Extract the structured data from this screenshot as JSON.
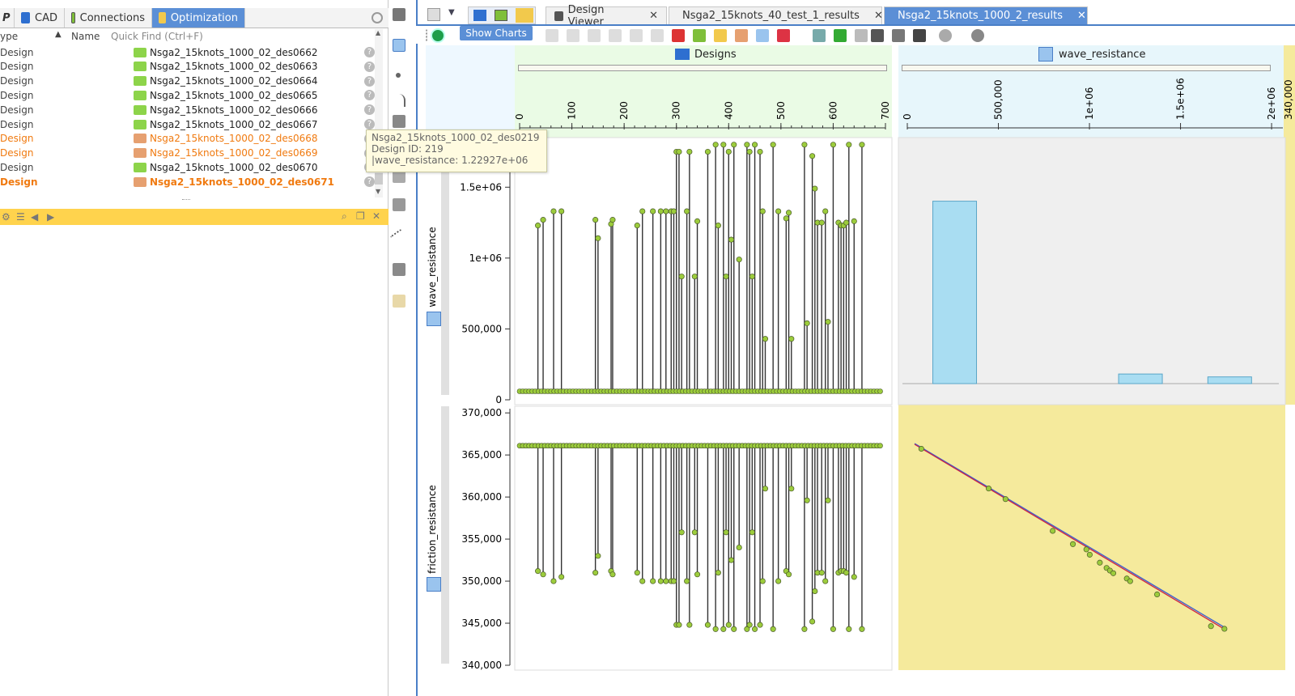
{
  "left_panel": {
    "tabs": [
      {
        "label": "P"
      },
      {
        "label": "CAD"
      },
      {
        "label": "Connections"
      },
      {
        "label": "Optimization"
      }
    ],
    "columns": {
      "type": "ype",
      "name": "Name",
      "quick_find": "Quick Find (Ctrl+F)"
    },
    "rows": [
      {
        "type": "Design",
        "name": "Nsga2_15knots_1000_02_des0662",
        "style": "normal"
      },
      {
        "type": "Design",
        "name": "Nsga2_15knots_1000_02_des0663",
        "style": "normal"
      },
      {
        "type": "Design",
        "name": "Nsga2_15knots_1000_02_des0664",
        "style": "normal"
      },
      {
        "type": "Design",
        "name": "Nsga2_15knots_1000_02_des0665",
        "style": "normal"
      },
      {
        "type": "Design",
        "name": "Nsga2_15knots_1000_02_des0666",
        "style": "normal"
      },
      {
        "type": "Design",
        "name": "Nsga2_15knots_1000_02_des0667",
        "style": "normal"
      },
      {
        "type": "Design",
        "name": "Nsga2_15knots_1000_02_des0668",
        "style": "orange"
      },
      {
        "type": "Design",
        "name": "Nsga2_15knots_1000_02_des0669",
        "style": "orange"
      },
      {
        "type": "Design",
        "name": "Nsga2_15knots_1000_02_des0670",
        "style": "normal"
      },
      {
        "type": "Design",
        "name": "Nsga2_15knots_1000_02_des0671",
        "style": "bold"
      }
    ]
  },
  "doc_tabs": [
    {
      "label": "Design Viewer"
    },
    {
      "label": "Nsga2_15knots_40_test_1_results"
    },
    {
      "label": "Nsga2_15knots_1000_2_results"
    }
  ],
  "toolbar": {
    "show_charts": "Show Charts"
  },
  "tooltip": {
    "line1": "Nsga2_15knots_1000_02_des0219",
    "line2": "Design ID: 219",
    "line3": "|wave_resistance: 1.22927e+06"
  },
  "panels": {
    "designs_title": "Designs",
    "wave_title": "wave_resistance"
  },
  "chart_data": [
    {
      "type": "scatter",
      "title": "",
      "xlabel": "Designs",
      "ylabel": "wave_resistance",
      "x_ticks": [
        "0",
        "100",
        "200",
        "300",
        "400",
        "500",
        "600",
        "700"
      ],
      "y_ticks": [
        "0",
        "500,000",
        "1e+06",
        "1.5e+06"
      ],
      "xlim": [
        0,
        700
      ],
      "ylim": [
        0,
        1850000
      ],
      "baseline": 60000,
      "spikes": [
        [
          35,
          1230000
        ],
        [
          45,
          1270000
        ],
        [
          65,
          1330000
        ],
        [
          80,
          1330000
        ],
        [
          145,
          1270000
        ],
        [
          150,
          1140000
        ],
        [
          175,
          1240000
        ],
        [
          178,
          1270000
        ],
        [
          225,
          1230000
        ],
        [
          235,
          1330000
        ],
        [
          255,
          1330000
        ],
        [
          270,
          1330000
        ],
        [
          280,
          1330000
        ],
        [
          290,
          1330000
        ],
        [
          295,
          1330000
        ],
        [
          300,
          1750000
        ],
        [
          305,
          1750000
        ],
        [
          310,
          870000
        ],
        [
          320,
          1330000
        ],
        [
          325,
          1750000
        ],
        [
          335,
          870000
        ],
        [
          340,
          1260000
        ],
        [
          360,
          1750000
        ],
        [
          375,
          1800000
        ],
        [
          380,
          1230000
        ],
        [
          390,
          1800000
        ],
        [
          395,
          870000
        ],
        [
          400,
          1750000
        ],
        [
          405,
          1130000
        ],
        [
          410,
          1800000
        ],
        [
          420,
          990000
        ],
        [
          435,
          1800000
        ],
        [
          440,
          1750000
        ],
        [
          445,
          870000
        ],
        [
          450,
          1800000
        ],
        [
          460,
          1750000
        ],
        [
          465,
          1330000
        ],
        [
          470,
          430000
        ],
        [
          485,
          1800000
        ],
        [
          495,
          1330000
        ],
        [
          510,
          1280000
        ],
        [
          515,
          1320000
        ],
        [
          520,
          430000
        ],
        [
          545,
          1800000
        ],
        [
          550,
          540000
        ],
        [
          560,
          1720000
        ],
        [
          565,
          1490000
        ],
        [
          570,
          1250000
        ],
        [
          578,
          1250000
        ],
        [
          585,
          1330000
        ],
        [
          590,
          550000
        ],
        [
          600,
          1800000
        ],
        [
          610,
          1250000
        ],
        [
          615,
          1230000
        ],
        [
          620,
          1230000
        ],
        [
          625,
          1250000
        ],
        [
          630,
          1800000
        ],
        [
          640,
          1260000
        ],
        [
          655,
          1800000
        ]
      ]
    },
    {
      "type": "scatter",
      "title": "",
      "xlabel": "",
      "ylabel": "friction_resistance",
      "x_ticks": [],
      "y_ticks": [
        "340,000",
        "345,000",
        "350,000",
        "355,000",
        "360,000",
        "365,000",
        "370,000"
      ],
      "xlim": [
        0,
        700
      ],
      "ylim": [
        340000,
        370500
      ],
      "baseline": 366100,
      "spikes": [
        [
          35,
          351200
        ],
        [
          45,
          350800
        ],
        [
          65,
          350000
        ],
        [
          80,
          350500
        ],
        [
          145,
          351000
        ],
        [
          150,
          353000
        ],
        [
          175,
          351200
        ],
        [
          178,
          350800
        ],
        [
          225,
          351000
        ],
        [
          235,
          350000
        ],
        [
          255,
          350000
        ],
        [
          270,
          350000
        ],
        [
          280,
          350000
        ],
        [
          290,
          350000
        ],
        [
          295,
          350000
        ],
        [
          300,
          344800
        ],
        [
          305,
          344800
        ],
        [
          310,
          355800
        ],
        [
          320,
          350000
        ],
        [
          325,
          344800
        ],
        [
          335,
          355800
        ],
        [
          340,
          350800
        ],
        [
          360,
          344800
        ],
        [
          375,
          344300
        ],
        [
          380,
          351000
        ],
        [
          390,
          344300
        ],
        [
          395,
          355800
        ],
        [
          400,
          344800
        ],
        [
          405,
          352500
        ],
        [
          410,
          344300
        ],
        [
          420,
          354000
        ],
        [
          435,
          344300
        ],
        [
          440,
          344800
        ],
        [
          445,
          355800
        ],
        [
          450,
          344300
        ],
        [
          460,
          344800
        ],
        [
          465,
          350000
        ],
        [
          470,
          361000
        ],
        [
          485,
          344300
        ],
        [
          495,
          350000
        ],
        [
          510,
          351200
        ],
        [
          515,
          350800
        ],
        [
          520,
          361000
        ],
        [
          545,
          344300
        ],
        [
          550,
          359600
        ],
        [
          560,
          345200
        ],
        [
          565,
          348800
        ],
        [
          570,
          351000
        ],
        [
          578,
          351000
        ],
        [
          585,
          350000
        ],
        [
          590,
          359600
        ],
        [
          600,
          344300
        ],
        [
          610,
          351000
        ],
        [
          615,
          351200
        ],
        [
          620,
          351200
        ],
        [
          625,
          351000
        ],
        [
          630,
          344300
        ],
        [
          640,
          350500
        ],
        [
          655,
          344300
        ]
      ]
    },
    {
      "type": "bar",
      "title": "wave_resistance",
      "x_ticks": [
        "0",
        "500,000",
        "1e+06",
        "1.5e+06",
        "2e+06"
      ],
      "xlim": [
        0,
        2000000
      ],
      "bins": [
        [
          140000,
          380000,
          0.95
        ],
        [
          1160000,
          1400000,
          0.05
        ],
        [
          1650000,
          1890000,
          0.035
        ]
      ]
    },
    {
      "type": "scatter",
      "xlabel": "wave_resistance",
      "ylabel": "friction_resistance",
      "points": [
        [
          0.02,
          0.02
        ],
        [
          0.22,
          0.17
        ],
        [
          0.27,
          0.21
        ],
        [
          0.41,
          0.33
        ],
        [
          0.47,
          0.38
        ],
        [
          0.51,
          0.4
        ],
        [
          0.52,
          0.42
        ],
        [
          0.55,
          0.45
        ],
        [
          0.57,
          0.47
        ],
        [
          0.58,
          0.48
        ],
        [
          0.59,
          0.49
        ],
        [
          0.63,
          0.51
        ],
        [
          0.64,
          0.52
        ],
        [
          0.72,
          0.57
        ],
        [
          0.88,
          0.69
        ],
        [
          0.92,
          0.7
        ]
      ],
      "fit_line_color": "#cc2244",
      "trend_line_color": "#3a5fcf"
    }
  ],
  "colors": {
    "accent": "#5b8fd6",
    "point": "#9ccc3c",
    "yellow_bg": "#f5ea9c",
    "green_hdr": "#eafbe5",
    "orange": "#f07a10"
  }
}
